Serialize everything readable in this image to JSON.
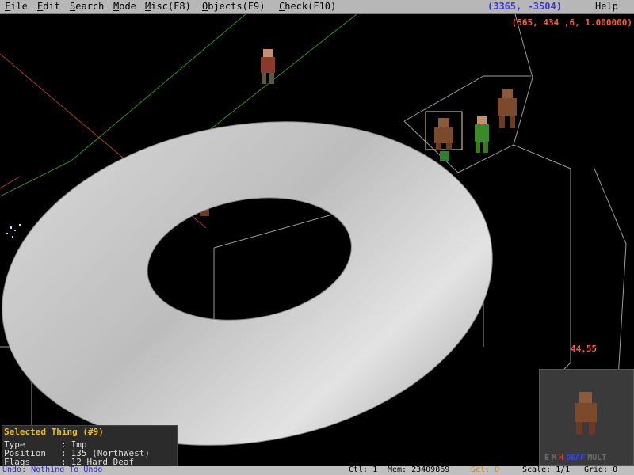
{
  "menu": [
    {
      "key": "F",
      "rest": "ile"
    },
    {
      "key": "E",
      "rest": "dit"
    },
    {
      "key": "S",
      "rest": "earch"
    },
    {
      "key": "M",
      "rest": "ode"
    },
    {
      "key": "M",
      "rest": "isc(F8)"
    },
    {
      "key": "O",
      "rest": "bjects(F9)"
    },
    {
      "key": "C",
      "rest": "heck(F10)"
    }
  ],
  "help": "Help",
  "map_coords": "(3365, -3504)",
  "cursor_info": "(565, 434 ,6, 1.000000)",
  "grid_readout": "44,55",
  "selected": {
    "title": "Selected Thing (#9)",
    "type_label": "Type",
    "type_value": "Imp",
    "position_label": "Position",
    "position_value": "135 (NorthWest)",
    "flags_label": "Flags",
    "flags_value": "12 Hard Deaf"
  },
  "preview_flags": [
    {
      "text": "E",
      "color": "#6b6b6b"
    },
    {
      "text": "M",
      "color": "#6b6b6b"
    },
    {
      "text": "H",
      "color": "#d03a2a"
    },
    {
      "text": "DEAF",
      "color": "#2a46ff"
    },
    {
      "text": "MULT",
      "color": "#6b6b6b"
    }
  ],
  "status": {
    "undo": "Undo: Nothing To Undo",
    "ctl": "Ctl: 1",
    "mem": "Mem: 23409869",
    "sel": "Sel: 0",
    "scale": "Scale: 1/1",
    "grid": "Grid: 0"
  },
  "colors": {
    "menubar": "#b7b7b7",
    "coord_blue": "#3a3ad8",
    "coord_red": "#ff5a3a",
    "sel_yellow": "#f0c000"
  }
}
